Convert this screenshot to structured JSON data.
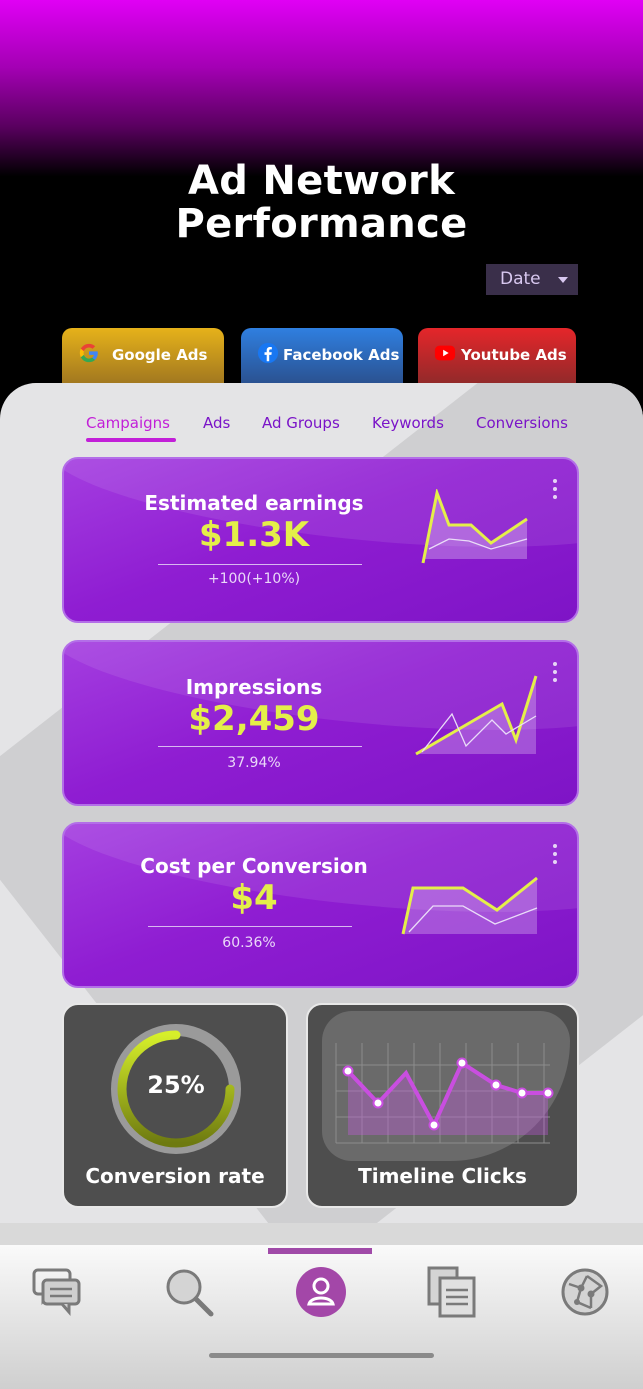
{
  "header": {
    "title_line1": "Ad Network",
    "title_line2": "Performance"
  },
  "date_filter": {
    "label": "Date"
  },
  "network_tabs": [
    {
      "label": "Google Ads",
      "icon": "google-icon"
    },
    {
      "label": "Facebook Ads",
      "icon": "facebook-icon"
    },
    {
      "label": "Youtube Ads",
      "icon": "youtube-icon"
    }
  ],
  "subtabs": [
    {
      "label": "Campaigns",
      "active": true
    },
    {
      "label": "Ads"
    },
    {
      "label": "Ad Groups"
    },
    {
      "label": "Keywords"
    },
    {
      "label": "Conversions"
    }
  ],
  "cards": [
    {
      "label": "Estimated earnings",
      "value": "$1.3K",
      "delta": "+100(+10%)"
    },
    {
      "label": "Impressions",
      "value": "$2,459",
      "delta": "37.94%"
    },
    {
      "label": "Cost per Conversion",
      "value": "$4",
      "delta": "60.36%"
    }
  ],
  "conversion_rate": {
    "value_text": "25%",
    "fraction": 0.25,
    "label": "Conversion rate"
  },
  "timeline_clicks": {
    "label": "Timeline Clicks"
  },
  "bottom_nav": [
    {
      "icon": "chat-icon"
    },
    {
      "icon": "search-icon"
    },
    {
      "icon": "profile-icon",
      "active": true
    },
    {
      "icon": "documents-icon"
    },
    {
      "icon": "globe-icon"
    }
  ],
  "colors": {
    "accent": "#c21fd8",
    "card": "#8f1dd2",
    "value": "#e4ef49",
    "dark_tile": "#4e4e4e"
  }
}
